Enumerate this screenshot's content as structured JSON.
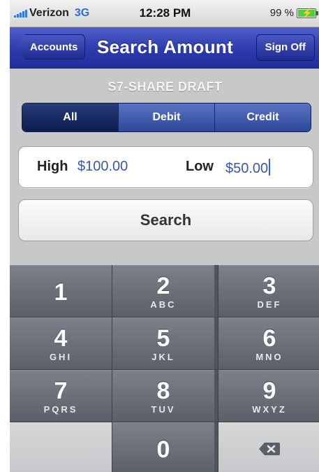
{
  "status_bar": {
    "carrier": "Verizon",
    "network": "3G",
    "time": "12:28 PM",
    "battery": "99 %",
    "battery_level": 0.99,
    "battery_color": "#4cd03a"
  },
  "nav": {
    "back_label": "Accounts",
    "title": "Search Amount",
    "right_label": "Sign Off",
    "color": "#2c3aab"
  },
  "account_name": "S7-SHARE DRAFT",
  "filter": {
    "options": [
      "All",
      "Debit",
      "Credit"
    ],
    "selected": "All"
  },
  "amount": {
    "high_label": "High",
    "high_value": "$100.00",
    "low_label": "Low",
    "low_value": "$50.00"
  },
  "search_button": "Search",
  "keypad": {
    "keys": [
      {
        "digit": "1",
        "letters": ""
      },
      {
        "digit": "2",
        "letters": "ABC"
      },
      {
        "digit": "3",
        "letters": "DEF"
      },
      {
        "digit": "4",
        "letters": "GHI"
      },
      {
        "digit": "5",
        "letters": "JKL"
      },
      {
        "digit": "6",
        "letters": "MNO"
      },
      {
        "digit": "7",
        "letters": "PQRS"
      },
      {
        "digit": "8",
        "letters": "TUV"
      },
      {
        "digit": "9",
        "letters": "WXYZ"
      },
      {
        "digit": "0",
        "letters": ""
      }
    ],
    "delete_icon": "backspace-icon"
  }
}
